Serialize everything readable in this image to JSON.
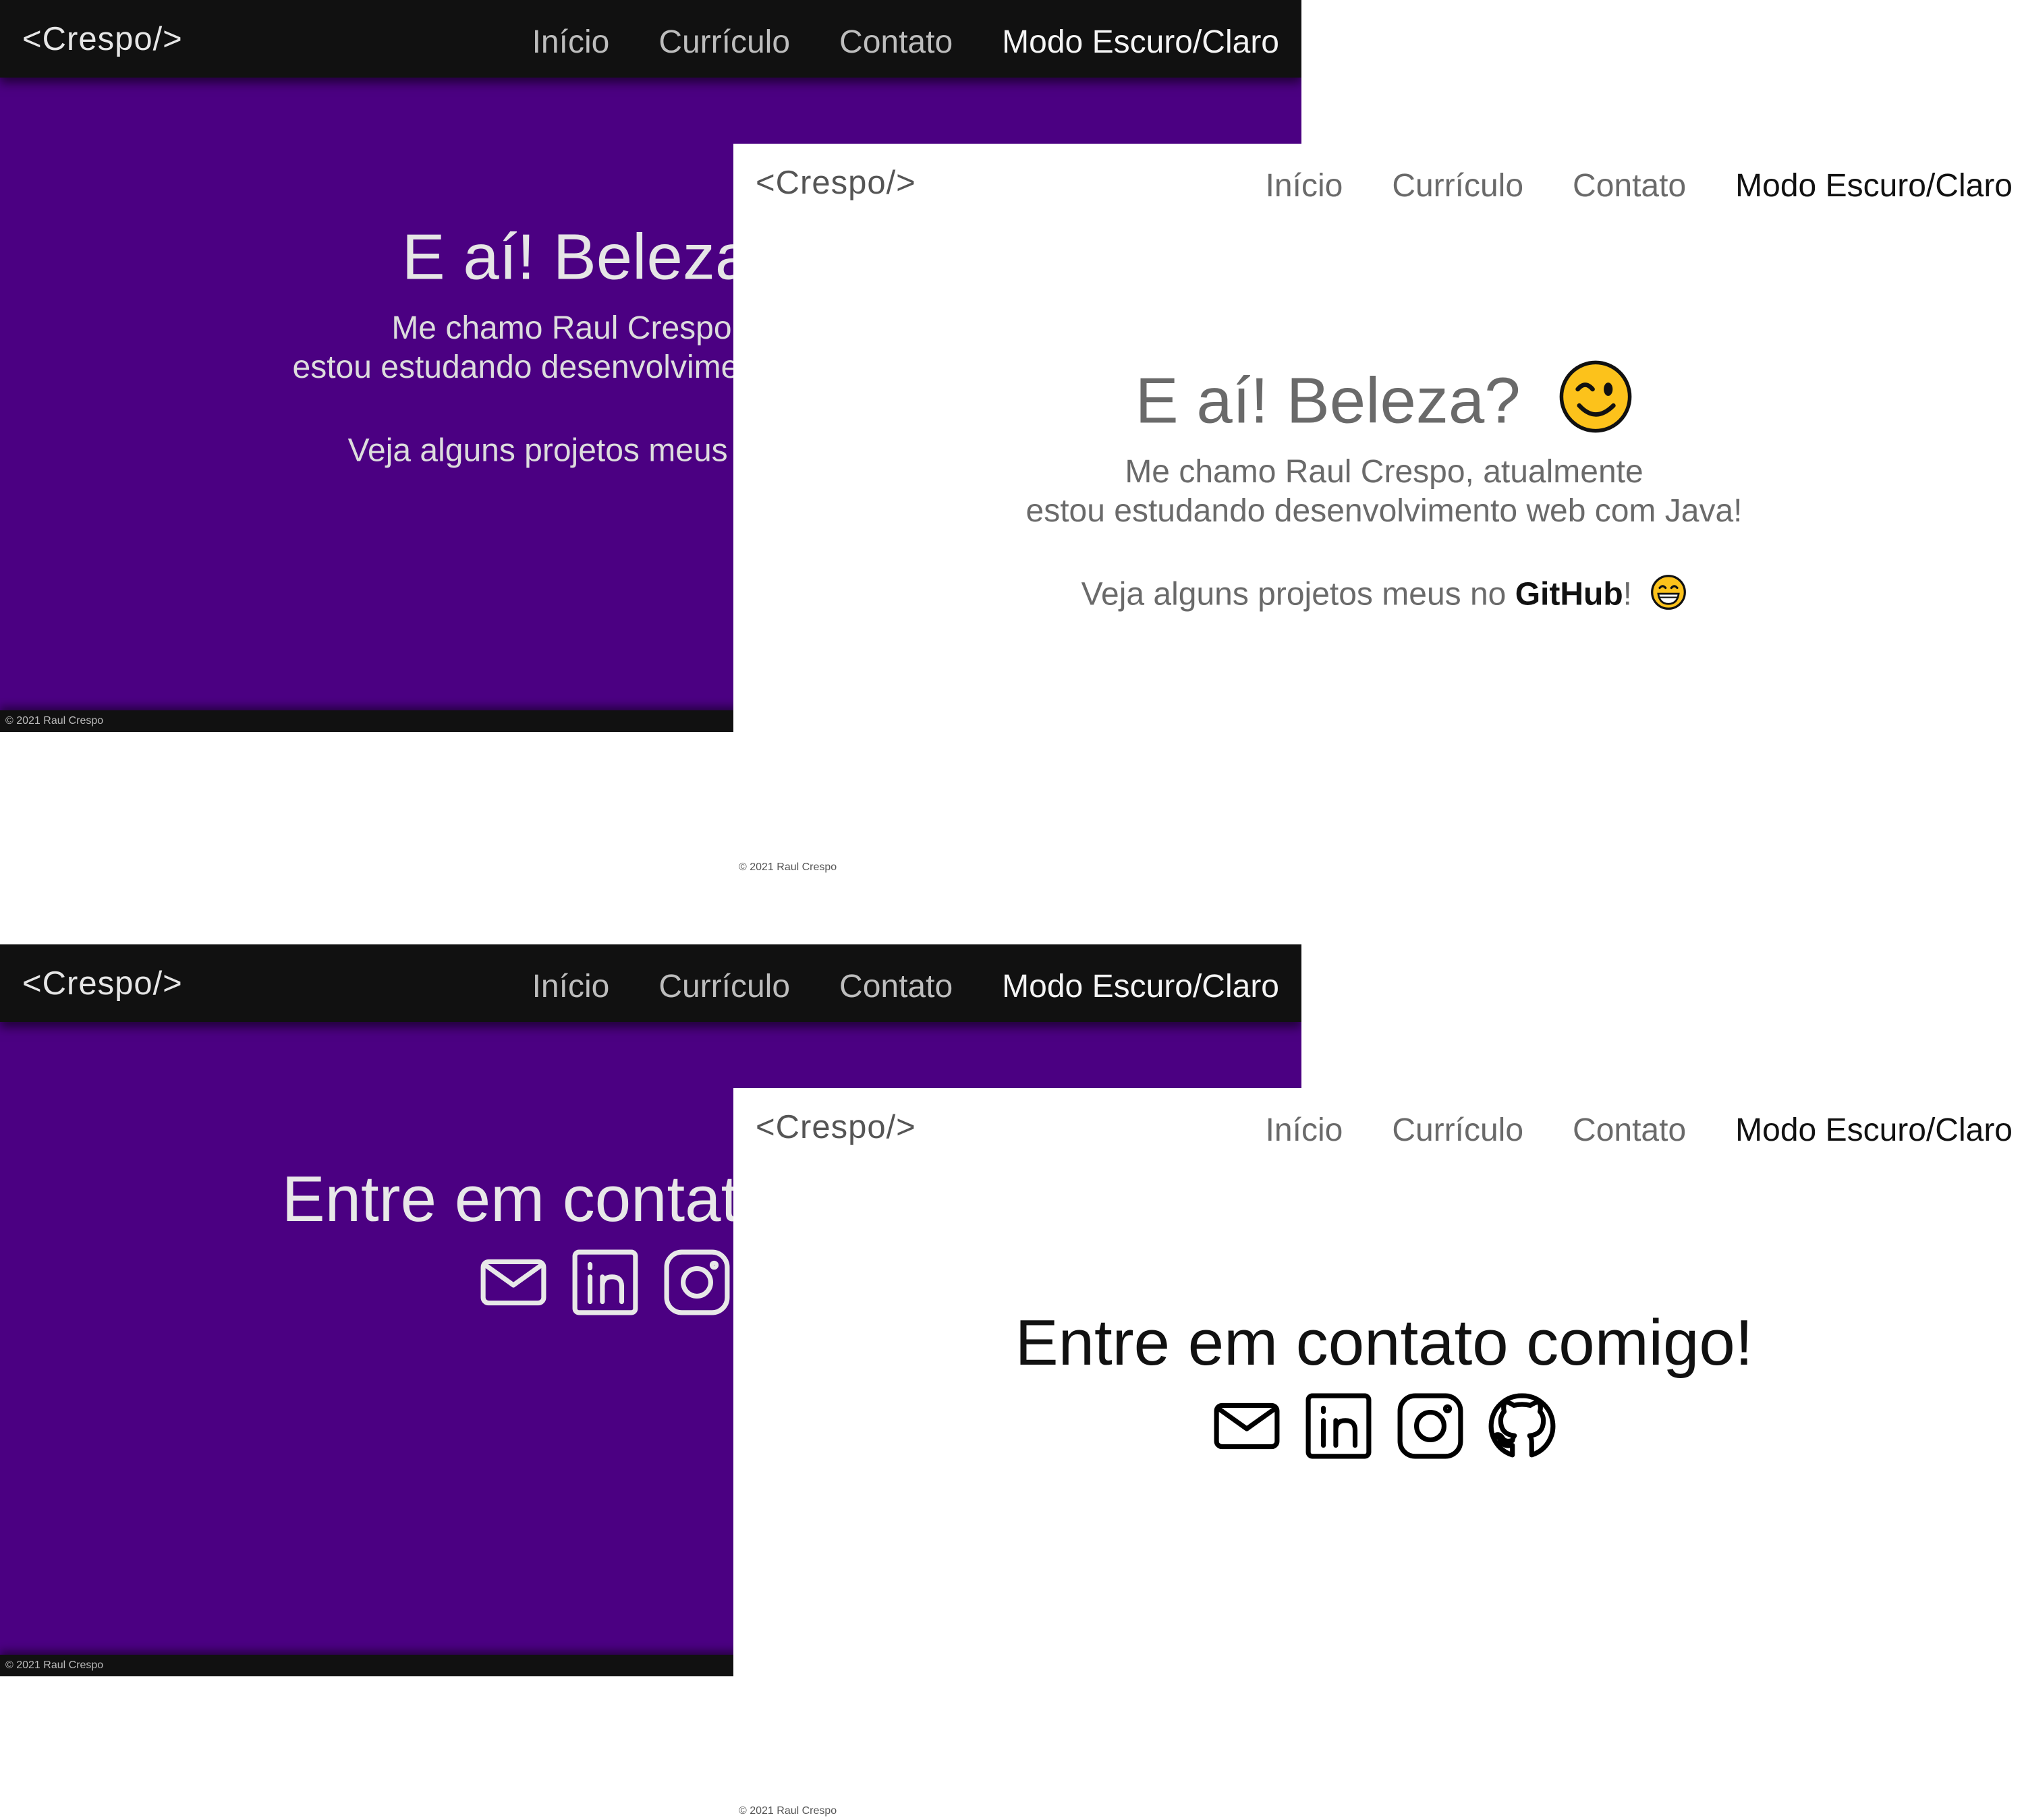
{
  "brand": "<Crespo/>",
  "nav": {
    "home": "Início",
    "resume": "Currículo",
    "contact": "Contato",
    "mode": "Modo Escuro/Claro"
  },
  "hero": {
    "title": "E aí! Beleza?",
    "line1": "Me chamo Raul Crespo, atualmente",
    "line2": "estou estudando desenvolvimento web com Java!",
    "github_prefix": "Veja alguns projetos meus no ",
    "github_link": "GitHub",
    "github_suffix": "!"
  },
  "contact": {
    "title": "Entre em contato comigo!"
  },
  "icons": [
    "wink-emoji-icon",
    "grin-emoji-icon",
    "mail-icon",
    "linkedin-icon",
    "instagram-icon",
    "github-icon"
  ],
  "footer": "© 2021 Raul Crespo",
  "colors": {
    "dark_background": "#4b0082",
    "dark_navbar": "#111111",
    "light_background": "#ffffff"
  }
}
